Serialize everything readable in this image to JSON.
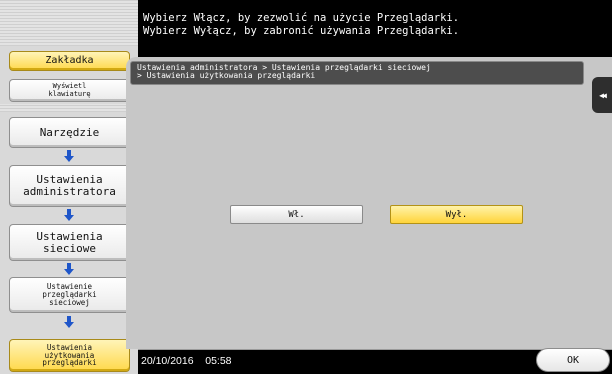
{
  "header": {
    "line1": "Wybierz Włącz, by zezwolić na użycie Przeglądarki.",
    "line2": "Wybierz Wyłącz, by zabronić używania Przeglądarki."
  },
  "sidebar": {
    "bookmark": "Zakładka",
    "show_keyboard": "Wyświetl\nklawiaturę",
    "steps": [
      "Narzędzie",
      "Ustawienia\nadministratora",
      "Ustawienia\nsieciowe",
      "Ustawienie\nprzeglądarki\nsieciowej",
      "Ustawienia\nużytkowania\nprzeglądarki"
    ]
  },
  "breadcrumb": {
    "line1": "Ustawienia administratora > Ustawienia przeglądarki sieciowej",
    "line2": "> Ustawienia użytkowania przeglądarki"
  },
  "panel": {
    "collapse_glyph": "◀◀",
    "on_label": "Wł.",
    "off_label": "Wył."
  },
  "footer": {
    "date": "20/10/2016",
    "time": "05:58",
    "ok_label": "OK"
  },
  "colors": {
    "selected_yellow": "#ffd84a",
    "panel_gray": "#c7c7c7",
    "arrow_blue": "#1f56c9"
  }
}
